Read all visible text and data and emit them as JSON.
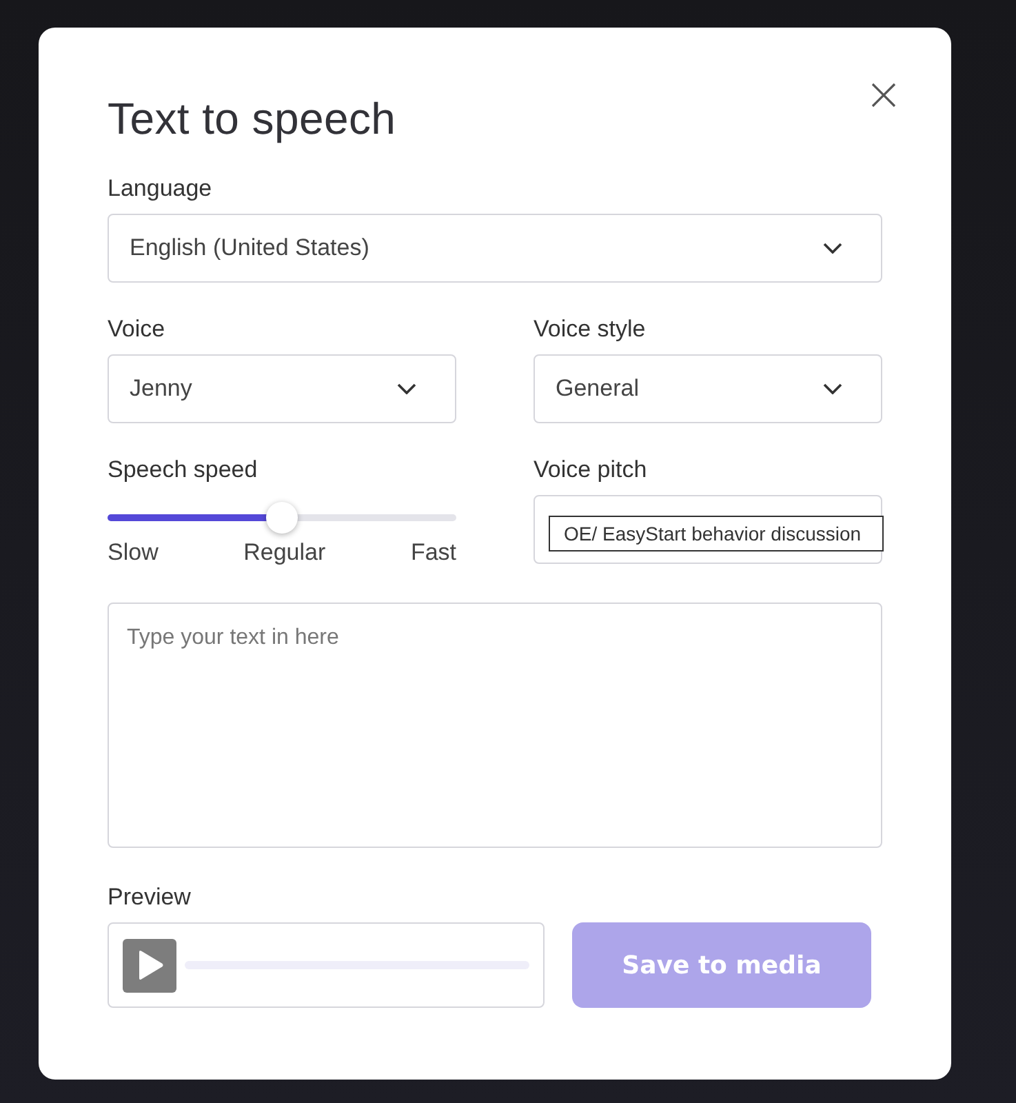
{
  "dialog": {
    "title": "Text to speech"
  },
  "language": {
    "label": "Language",
    "value": "English (United States)"
  },
  "voice": {
    "label": "Voice",
    "value": "Jenny"
  },
  "voice_style": {
    "label": "Voice style",
    "value": "General"
  },
  "speech_speed": {
    "label": "Speech speed",
    "level": 0.5,
    "marks": [
      "Slow",
      "Regular",
      "Fast"
    ]
  },
  "voice_pitch": {
    "label": "Voice pitch",
    "tooltip": "OE/ EasyStart behavior discussion"
  },
  "text_input": {
    "placeholder": "Type your text in here"
  },
  "preview": {
    "label": "Preview"
  },
  "save_button": {
    "label": "Save to media",
    "disabled": true
  }
}
